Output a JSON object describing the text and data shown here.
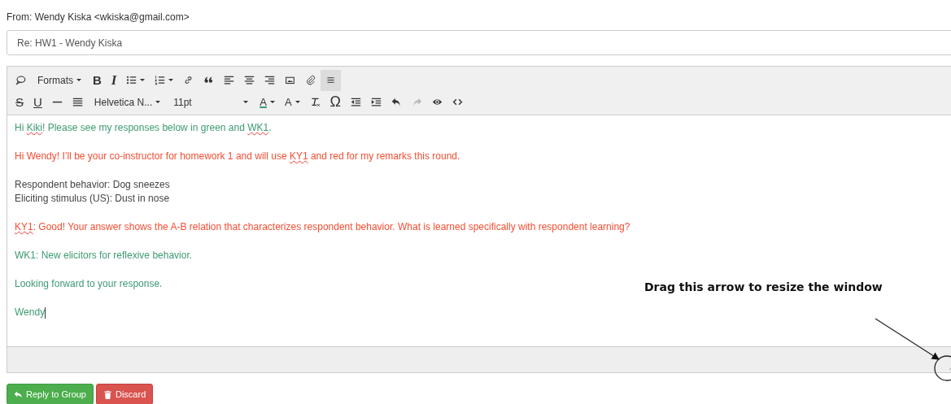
{
  "from": "From: Wendy Kiska <wkiska@gmail.com>",
  "subject": {
    "value": "Re: HW1 - Wendy Kiska"
  },
  "toolbar": [
    [
      {
        "kind": "icon",
        "active": false,
        "disabled": false
      },
      {
        "kind": "dropdown",
        "label": "Formats",
        "active": false,
        "disabled": false
      },
      {
        "kind": "glyph",
        "label": "B",
        "active": false,
        "disabled": false
      },
      {
        "kind": "glyph",
        "label": "I",
        "active": false,
        "disabled": false
      },
      {
        "kind": "split",
        "active": false,
        "disabled": false
      },
      {
        "kind": "split",
        "active": false,
        "disabled": false
      },
      {
        "kind": "icon",
        "active": false,
        "disabled": false
      },
      {
        "kind": "icon",
        "active": false,
        "disabled": false
      },
      {
        "kind": "icon",
        "active": false,
        "disabled": false
      },
      {
        "kind": "icon",
        "active": false,
        "disabled": false
      },
      {
        "kind": "icon",
        "active": false,
        "disabled": false
      },
      {
        "kind": "icon",
        "active": false,
        "disabled": false
      },
      {
        "kind": "icon",
        "active": false,
        "disabled": false
      },
      {
        "kind": "icon",
        "active": true,
        "disabled": false
      }
    ],
    [
      {
        "kind": "glyph",
        "label": "S",
        "active": false,
        "disabled": false
      },
      {
        "kind": "glyph",
        "label": "U",
        "active": false,
        "disabled": false
      },
      {
        "kind": "icon",
        "active": false,
        "disabled": false
      },
      {
        "kind": "icon",
        "active": false,
        "disabled": false
      },
      {
        "kind": "dropdown",
        "label": "Helvetica N...",
        "active": false,
        "disabled": false
      },
      {
        "kind": "dropdown",
        "label": "11pt",
        "active": false,
        "disabled": false
      },
      {
        "kind": "glyphsplit",
        "label": "A",
        "active": false,
        "disabled": false
      },
      {
        "kind": "glyphsplit",
        "label": "A",
        "active": false,
        "disabled": false
      },
      {
        "kind": "icon",
        "active": false,
        "disabled": false
      },
      {
        "kind": "glyph",
        "label": "Ω",
        "active": false,
        "disabled": false
      },
      {
        "kind": "icon",
        "active": false,
        "disabled": false
      },
      {
        "kind": "icon",
        "active": false,
        "disabled": false
      },
      {
        "kind": "icon",
        "active": false,
        "disabled": false
      },
      {
        "kind": "icon",
        "active": false,
        "disabled": true
      },
      {
        "kind": "icon",
        "active": false,
        "disabled": false
      },
      {
        "kind": "icon",
        "active": false,
        "disabled": false
      }
    ]
  ],
  "body": [
    {
      "color": "#3d9a72",
      "lines": [
        [
          {
            "text": "Hi ",
            "misspelled": false
          },
          {
            "text": "Kiki",
            "misspelled": true
          },
          {
            "text": "! Please see my responses below in green and ",
            "misspelled": false
          },
          {
            "text": "WK1",
            "misspelled": true
          },
          {
            "text": ".",
            "misspelled": false
          }
        ]
      ]
    },
    {
      "color": "#f24e32",
      "lines": [
        [
          {
            "text": "Hi Wendy! I’ll be your co-instructor for homework 1 and will use ",
            "misspelled": false
          },
          {
            "text": "KY1",
            "misspelled": true
          },
          {
            "text": " and red for my remarks this round.",
            "misspelled": false
          }
        ]
      ]
    },
    {
      "color": "#444444",
      "lines": [
        [
          {
            "text": "Respondent behavior: Dog sneezes",
            "misspelled": false
          }
        ],
        [
          {
            "text": "Eliciting stimulus (US): Dust in nose",
            "misspelled": false
          }
        ]
      ]
    },
    {
      "color": "#f24e32",
      "lines": [
        [
          {
            "text": "KY1",
            "misspelled": true
          },
          {
            "text": ": Good! Your answer shows the A-B relation that characterizes respondent behavior. What is learned specifically with respondent learning?",
            "misspelled": false
          }
        ]
      ]
    },
    {
      "color": "#3d9a72",
      "lines": [
        [
          {
            "text": "WK1: New elicitors for reflexive behavior.",
            "misspelled": false
          }
        ]
      ]
    },
    {
      "color": "#3d9a72",
      "lines": [
        [
          {
            "text": "Looking forward to your response.",
            "misspelled": false
          }
        ]
      ]
    },
    {
      "color": "#3d9a72",
      "lines": [
        [
          {
            "text": "Wendy",
            "misspelled": false
          }
        ]
      ]
    }
  ],
  "annotation": "Drag this arrow to resize the window",
  "buttons": [
    {
      "kind": "reply",
      "label": "Reply to Group"
    },
    {
      "kind": "discard",
      "label": "Discard"
    }
  ]
}
